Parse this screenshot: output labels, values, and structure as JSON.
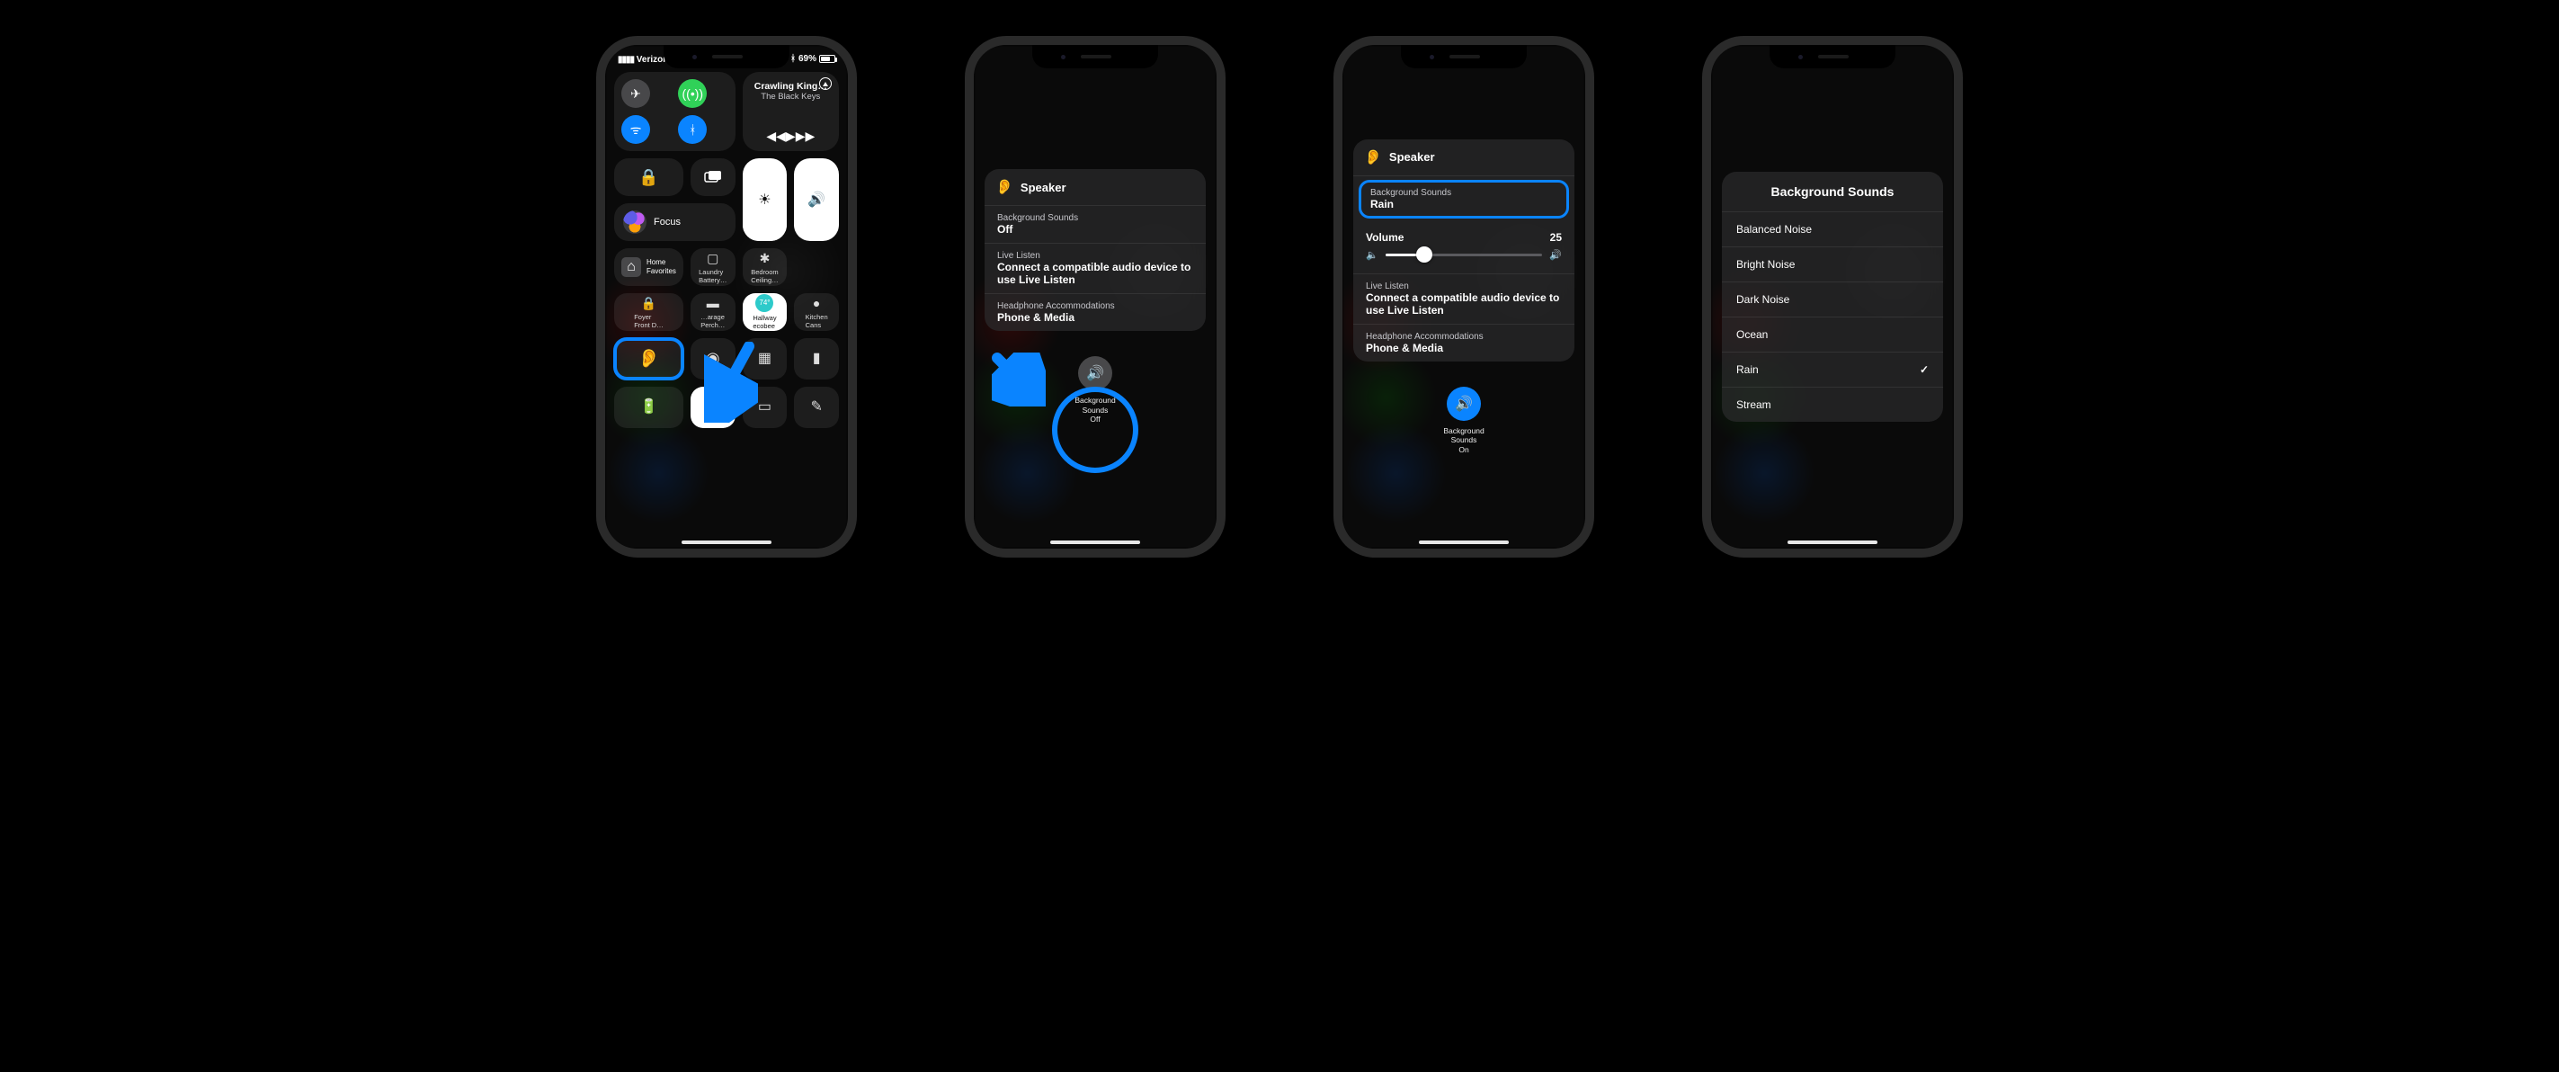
{
  "status": {
    "carrier": "Verizon",
    "battery": "69%"
  },
  "media": {
    "title": "Crawling King…",
    "artist": "The Black Keys"
  },
  "focus": {
    "label": "Focus"
  },
  "home_tiles": {
    "home_l1": "Home",
    "home_l2": "Favorites",
    "laundry_l1": "Laundry",
    "laundry_l2": "Battery…",
    "bedroom_l1": "Bedroom",
    "bedroom_l2": "Ceiling…",
    "foyer_l1": "Foyer",
    "foyer_l2": "Front D…",
    "garage_l1": "…arage",
    "garage_l2": "Perch…",
    "hallway_temp": "74°",
    "hallway_l1": "Hallway",
    "hallway_l2": "ecobee",
    "kitchen_l1": "Kitchen",
    "kitchen_l2": "Cans"
  },
  "hearing": {
    "speaker": "Speaker",
    "bg_label": "Background Sounds",
    "bg_off": "Off",
    "bg_rain": "Rain",
    "vol_label": "Volume",
    "vol_value": "25",
    "live_label": "Live Listen",
    "live_value": "Connect a compatible audio device to use Live Listen",
    "acc_label": "Headphone Accommodations",
    "acc_value": "Phone & Media",
    "btn_l1": "Background",
    "btn_l2": "Sounds",
    "btn_off": "Off",
    "btn_on": "On"
  },
  "sounds": {
    "title": "Background Sounds",
    "items": [
      "Balanced Noise",
      "Bright Noise",
      "Dark Noise",
      "Ocean",
      "Rain",
      "Stream"
    ],
    "selected": "Rain"
  }
}
